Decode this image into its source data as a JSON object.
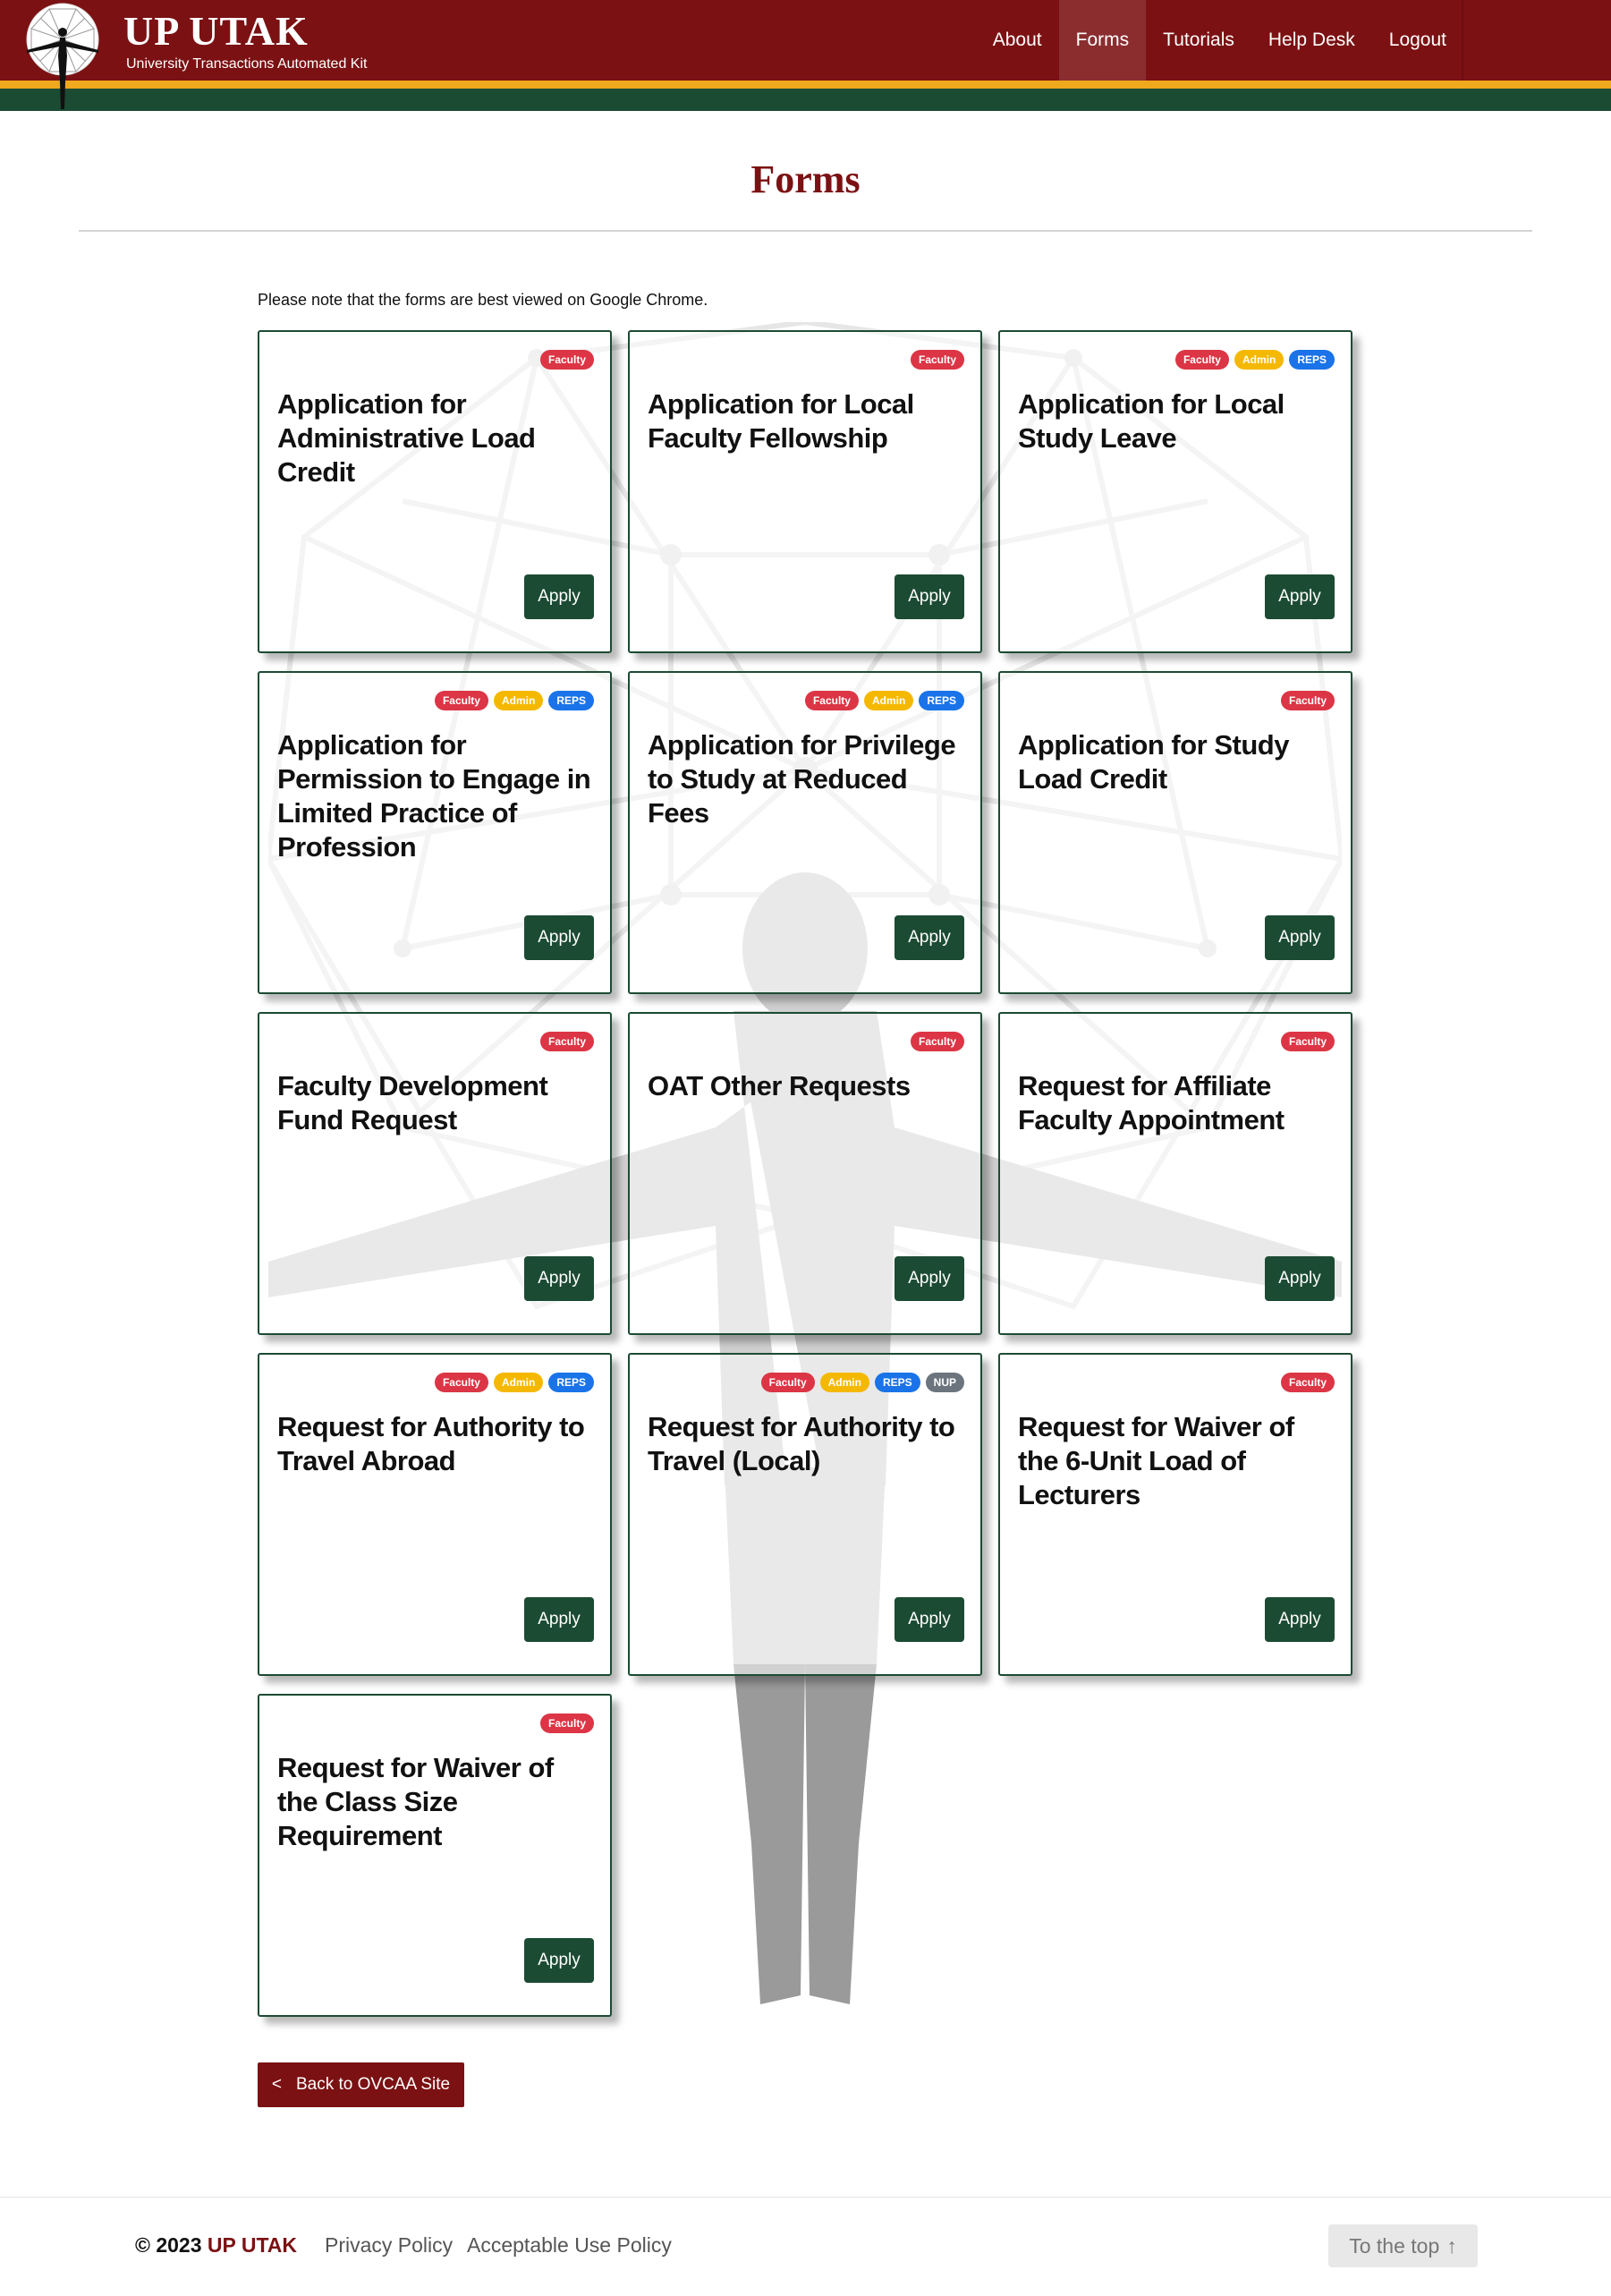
{
  "header": {
    "brand_title": "UP UTAK",
    "brand_subtitle": "University Transactions Automated Kit",
    "nav": [
      {
        "label": "About"
      },
      {
        "label": "Forms"
      },
      {
        "label": "Tutorials"
      },
      {
        "label": "Help Desk"
      },
      {
        "label": "Logout"
      }
    ],
    "active_nav": "Forms",
    "colors": {
      "maroon": "#7b1113",
      "gold": "#f0a81c",
      "green": "#1c4b33"
    }
  },
  "page": {
    "title": "Forms",
    "note": "Please note that the forms are best viewed on Google Chrome."
  },
  "cards": [
    {
      "title": "Application for Administrative Load Credit",
      "badges": [
        "Faculty"
      ],
      "button": "Apply"
    },
    {
      "title": "Application for Local Faculty Fellowship",
      "badges": [
        "Faculty"
      ],
      "button": "Apply"
    },
    {
      "title": "Application for Local Study Leave",
      "badges": [
        "Faculty",
        "Admin",
        "REPS"
      ],
      "button": "Apply"
    },
    {
      "title": "Application for Permission to Engage in Limited Practice of Profession",
      "badges": [
        "Faculty",
        "Admin",
        "REPS"
      ],
      "button": "Apply"
    },
    {
      "title": "Application for Privilege to Study at Reduced Fees",
      "badges": [
        "Faculty",
        "Admin",
        "REPS"
      ],
      "button": "Apply"
    },
    {
      "title": "Application for Study Load Credit",
      "badges": [
        "Faculty"
      ],
      "button": "Apply"
    },
    {
      "title": "Faculty Development Fund Request",
      "badges": [
        "Faculty"
      ],
      "button": "Apply"
    },
    {
      "title": "OAT Other Requests",
      "badges": [
        "Faculty"
      ],
      "button": "Apply"
    },
    {
      "title": "Request for Affiliate Faculty Appointment",
      "badges": [
        "Faculty"
      ],
      "button": "Apply"
    },
    {
      "title": "Request for Authority to Travel Abroad",
      "badges": [
        "Faculty",
        "Admin",
        "REPS"
      ],
      "button": "Apply"
    },
    {
      "title": "Request for Authority to Travel (Local)",
      "badges": [
        "Faculty",
        "Admin",
        "REPS",
        "NUP"
      ],
      "button": "Apply"
    },
    {
      "title": "Request for Waiver of the 6-Unit Load of Lecturers",
      "badges": [
        "Faculty"
      ],
      "button": "Apply"
    },
    {
      "title": "Request for Waiver of the Class Size Requirement",
      "badges": [
        "Faculty"
      ],
      "button": "Apply"
    }
  ],
  "back_button": {
    "label": "Back to OVCAA Site",
    "icon": "chevron-left-icon"
  },
  "footer": {
    "copyright_prefix": "© 2023",
    "copyright_brand": "UP UTAK",
    "links": [
      "Privacy Policy",
      "Acceptable Use Policy"
    ],
    "to_top": "To the top",
    "to_top_icon": "arrow-up-icon"
  }
}
